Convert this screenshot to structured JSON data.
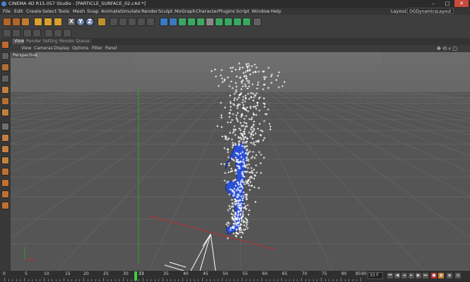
{
  "window": {
    "title": "CINEMA 4D R15.057 Studio - [PARTICLE_SURFACE_02.c4d *]",
    "minimize": "–",
    "maximize": "□",
    "close": "✕"
  },
  "menu": {
    "items": [
      "File",
      "Edit",
      "Create",
      "Select",
      "Tools",
      "Mesh",
      "Snap",
      "Animate",
      "Simulate",
      "Render",
      "Sculpt",
      "MoGraph",
      "Character",
      "Plugins",
      "Script",
      "Window",
      "Help"
    ],
    "layout_label": "Layout:",
    "layout_value": "OGDynamicsLayout"
  },
  "toolbar": {
    "axis_labels": [
      "X",
      "Y",
      "Z"
    ]
  },
  "viewport": {
    "tabs": [
      "View",
      "Render Settings",
      "Render Queue"
    ],
    "menu": [
      "View",
      "Cameras",
      "Display",
      "Options",
      "Filter",
      "Panel"
    ],
    "camera_label": "Perspective",
    "nav_icons": "✥ ⟲ ⌕ ▢"
  },
  "timeline": {
    "labels": [
      "0",
      "5",
      "10",
      "15",
      "20",
      "25",
      "30",
      "35",
      "40",
      "45",
      "50",
      "55",
      "60",
      "65",
      "70",
      "75",
      "80",
      "85",
      "90"
    ],
    "playhead_label": "33",
    "current_frame_field": "33 F",
    "current_frame": 33,
    "max_frame": 90
  },
  "colors": {
    "grid_line": "#6a6a6a",
    "floor": "#555555",
    "sky": "#707070",
    "particles": "#ffffff",
    "object_blue": "#2a4fd6",
    "axis_x": "#c03030",
    "axis_y": "#30a030",
    "accent": "#f0a020"
  }
}
